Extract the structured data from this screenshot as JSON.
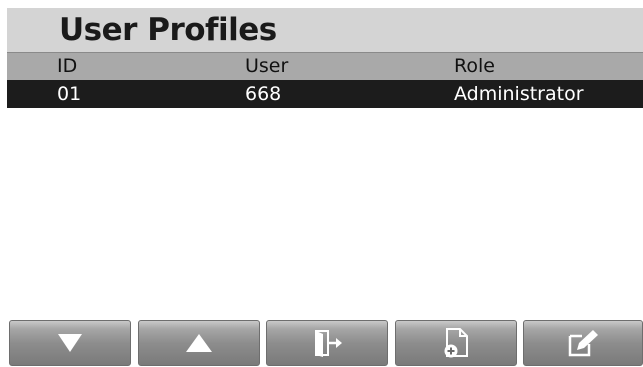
{
  "title": "User Profiles",
  "table": {
    "columns": [
      "ID",
      "User",
      "Role"
    ],
    "rows": [
      {
        "id": "01",
        "user": "668",
        "role": "Administrator",
        "selected": true
      }
    ]
  },
  "toolbar": {
    "buttons": [
      {
        "icon": "down-arrow-icon",
        "action": "scroll-down"
      },
      {
        "icon": "up-arrow-icon",
        "action": "scroll-up"
      },
      {
        "icon": "exit-door-icon",
        "action": "exit"
      },
      {
        "icon": "add-document-icon",
        "action": "add-profile"
      },
      {
        "icon": "edit-icon",
        "action": "edit-profile"
      }
    ]
  },
  "colors": {
    "title_bar": "#d4d4d4",
    "header_row": "#a9a9a9",
    "selected_row": "#1c1c1c",
    "selected_text": "#ffffff",
    "button_gradient_top": "#c9c9c9",
    "button_gradient_bottom": "#7a7a7a"
  }
}
